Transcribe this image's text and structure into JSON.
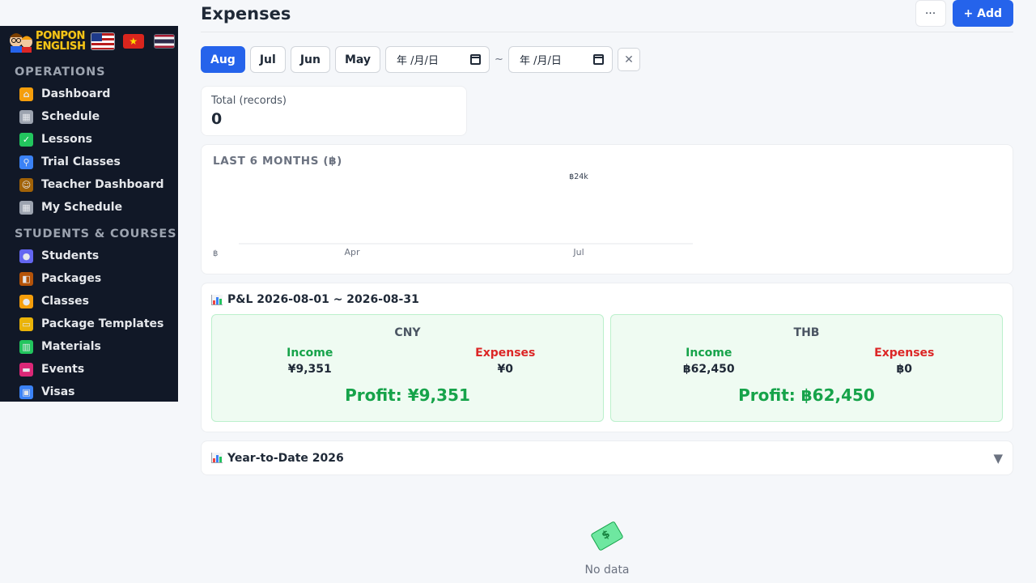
{
  "sidebar": {
    "brand": {
      "line1": "PONPON",
      "line2": "ENGLISH"
    },
    "sections": [
      {
        "label": "OPERATIONS",
        "items": [
          {
            "label": "Dashboard",
            "icon": "house-icon",
            "color": "#f59e0b"
          },
          {
            "label": "Schedule",
            "icon": "calendar-icon",
            "color": "#9ca3af"
          },
          {
            "label": "Lessons",
            "icon": "check-icon",
            "color": "#22c55e"
          },
          {
            "label": "Trial Classes",
            "icon": "magnifier-icon",
            "color": "#3b82f6"
          },
          {
            "label": "Teacher Dashboard",
            "icon": "teacher-icon",
            "color": "#a16207"
          },
          {
            "label": "My Schedule",
            "icon": "calendar-icon",
            "color": "#9ca3af"
          }
        ]
      },
      {
        "label": "STUDENTS & COURSES",
        "items": [
          {
            "label": "Students",
            "icon": "people-icon",
            "color": "#6366f1"
          },
          {
            "label": "Packages",
            "icon": "box-icon",
            "color": "#b45309"
          },
          {
            "label": "Classes",
            "icon": "group-icon",
            "color": "#f59e0b"
          },
          {
            "label": "Package Templates",
            "icon": "folder-icon",
            "color": "#eab308"
          },
          {
            "label": "Materials",
            "icon": "books-icon",
            "color": "#22c55e"
          },
          {
            "label": "Events",
            "icon": "ticket-icon",
            "color": "#db2777"
          },
          {
            "label": "Visas",
            "icon": "passport-icon",
            "color": "#3b82f6"
          }
        ]
      }
    ]
  },
  "header": {
    "title": "Expenses",
    "more_label": "···",
    "add_label": "+ Add"
  },
  "filters": {
    "months": [
      "Aug",
      "Jul",
      "Jun",
      "May"
    ],
    "active_month": "Aug",
    "date_from_placeholder": "年 /月/日",
    "date_to_placeholder": "年 /月/日",
    "separator": "~",
    "clear_label": "✕"
  },
  "total": {
    "label": "Total (records)",
    "value": "0"
  },
  "chart": {
    "title": "LAST 6 MONTHS (฿)"
  },
  "chart_data": {
    "type": "bar",
    "title": "LAST 6 MONTHS (฿)",
    "categories": [
      "Apr",
      "Jul"
    ],
    "y_axis_label": "฿",
    "annotations": [
      {
        "category": "Jul",
        "label": "฿24k"
      }
    ],
    "grid": false
  },
  "pl": {
    "title": "P&L 2026-08-01 ~ 2026-08-31",
    "boxes": [
      {
        "currency": "CNY",
        "income_label": "Income",
        "income": "¥9,351",
        "expenses_label": "Expenses",
        "expenses": "¥0",
        "profit": "Profit: ¥9,351"
      },
      {
        "currency": "THB",
        "income_label": "Income",
        "income": "฿62,450",
        "expenses_label": "Expenses",
        "expenses": "฿0",
        "profit": "Profit: ฿62,450"
      }
    ]
  },
  "ytd": {
    "title": "Year-to-Date 2026",
    "chevron": "▼"
  },
  "empty": {
    "text": "No data"
  },
  "colors": {
    "accent": "#2563eb",
    "sidebar": "#111827",
    "income": "#16a34a",
    "expense": "#dc2626",
    "profit_bg": "#effbf2"
  }
}
